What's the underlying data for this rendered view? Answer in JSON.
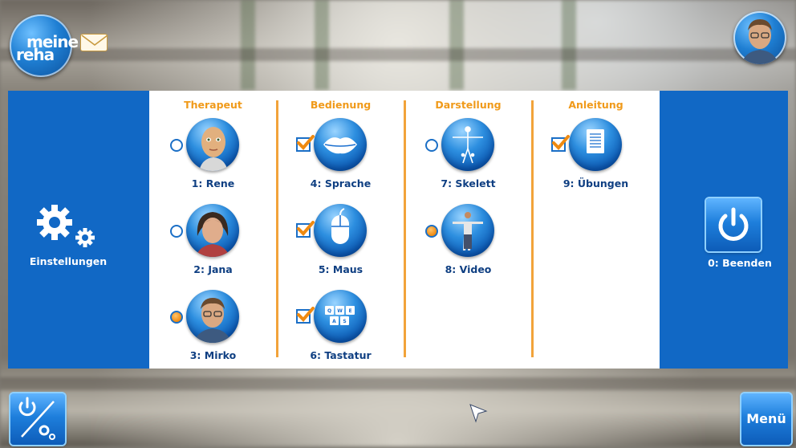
{
  "header": {
    "logo_line1": "meine",
    "logo_line2": "reha",
    "icons": {
      "mail": "mail-icon",
      "user": "user-avatar"
    }
  },
  "left_panel": {
    "label": "Einstellungen",
    "icon": "gears-icon"
  },
  "columns": [
    {
      "title": "Therapeut",
      "items": [
        {
          "label": "1: Rene",
          "selector": "radio",
          "selected": false,
          "icon": "avatar-rene"
        },
        {
          "label": "2: Jana",
          "selector": "radio",
          "selected": false,
          "icon": "avatar-jana"
        },
        {
          "label": "3: Mirko",
          "selector": "radio",
          "selected": true,
          "icon": "avatar-mirko"
        }
      ]
    },
    {
      "title": "Bedienung",
      "items": [
        {
          "label": "4: Sprache",
          "selector": "checkbox",
          "selected": true,
          "icon": "lips-icon"
        },
        {
          "label": "5: Maus",
          "selector": "checkbox",
          "selected": true,
          "icon": "mouse-icon"
        },
        {
          "label": "6: Tastatur",
          "selector": "checkbox",
          "selected": true,
          "icon": "keyboard-icon",
          "keys": [
            "Q",
            "W",
            "E",
            "A",
            "S"
          ]
        }
      ]
    },
    {
      "title": "Darstellung",
      "items": [
        {
          "label": "7: Skelett",
          "selector": "radio",
          "selected": false,
          "icon": "skeleton-icon"
        },
        {
          "label": "8: Video",
          "selector": "radio",
          "selected": true,
          "icon": "video-person-icon"
        }
      ]
    },
    {
      "title": "Anleitung",
      "items": [
        {
          "label": "9: Übungen",
          "selector": "checkbox",
          "selected": true,
          "icon": "document-icon"
        }
      ]
    }
  ],
  "right_panel": {
    "label": "0: Beenden",
    "icon": "power-icon"
  },
  "footer": {
    "menu_label": "Menü",
    "switch_icon": "power-settings-icon"
  },
  "colors": {
    "band": "#1168c5",
    "accent": "#f09a1a",
    "label": "#0f3f82"
  }
}
